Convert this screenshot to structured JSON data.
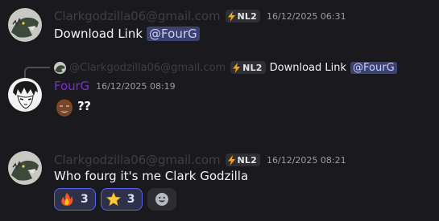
{
  "messages": [
    {
      "username": "Clarkgodzilla06@gmail.com",
      "tag": "NL2",
      "timestamp": "16/12/2025 06:31",
      "text": "Download Link",
      "mention": "@FourG"
    },
    {
      "reply": {
        "username": "@Clarkgodzilla06@gmail.com",
        "tag": "NL2",
        "text": "Download Link",
        "mention": "@FourG"
      },
      "username": "FourG",
      "timestamp": "16/12/2025 08:19",
      "text": "??"
    },
    {
      "username": "Clarkgodzilla06@gmail.com",
      "tag": "NL2",
      "timestamp": "16/12/2025 08:21",
      "text": "Who fourg it's me Clark Godzilla",
      "reactions": [
        {
          "emoji": "fire-emoji",
          "count": "3"
        },
        {
          "emoji": "star-emoji",
          "count": "3"
        }
      ]
    }
  ],
  "colors": {
    "background": "#1a1a1e",
    "fourg_name": "#7b2ecf",
    "mention_bg": "#3c4270",
    "reaction_border": "#5865f2"
  },
  "icons": {
    "tag_icon": "lightning-bolt-icon",
    "add_reaction": "smiley-add-reaction-icon"
  }
}
